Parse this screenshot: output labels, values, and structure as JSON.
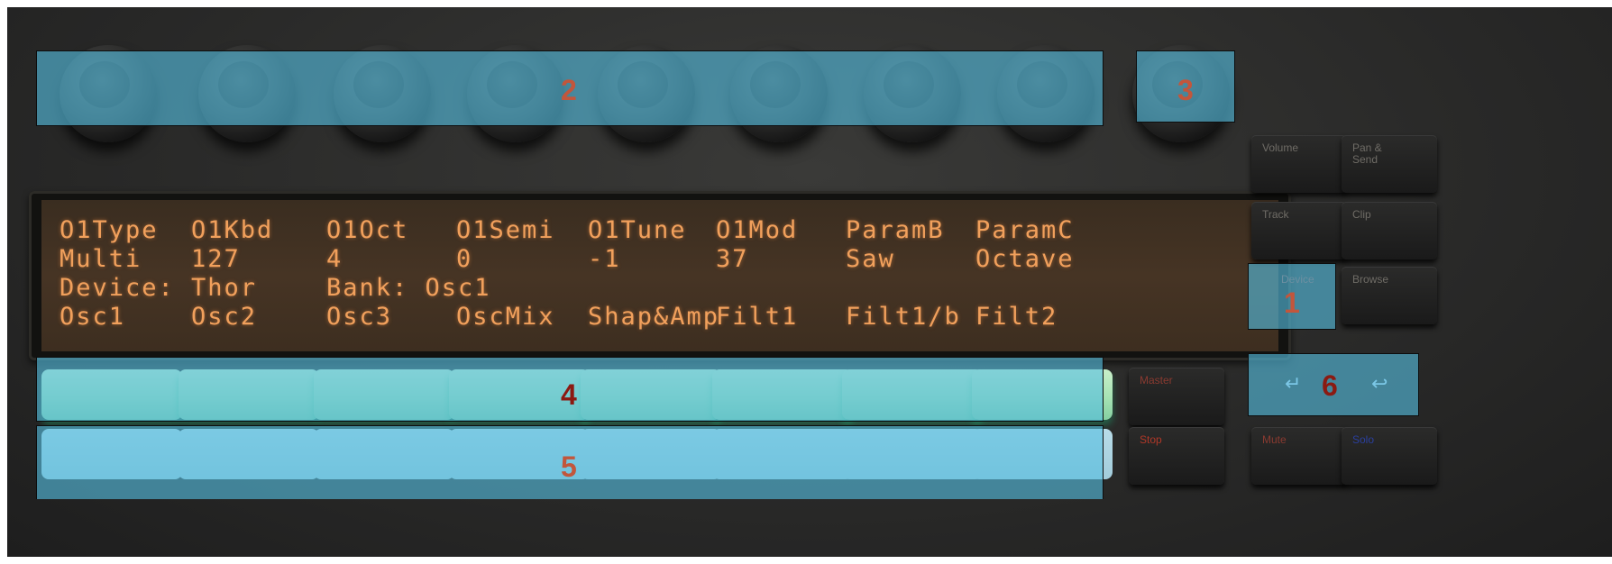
{
  "display": {
    "row1": [
      "O1Type",
      "O1Kbd",
      "O1Oct",
      "O1Semi",
      "O1Tune",
      "O1Mod",
      "ParamB",
      "ParamC"
    ],
    "row2": [
      "Multi",
      "127",
      "4",
      "0",
      "-1",
      "37",
      "Saw",
      "Octave"
    ],
    "device": "Device: Thor",
    "bank": "Bank: Osc1",
    "row4": [
      "Osc1",
      "Osc2",
      "Osc3",
      "OscMix",
      "Shap&Amp",
      "Filt1",
      "Filt1/b",
      "Filt2"
    ]
  },
  "side_buttons": {
    "volume": "Volume",
    "pan_send": "Pan &\nSend",
    "track": "Track",
    "clip": "Clip",
    "device": "Device",
    "browse": "Browse",
    "master": "Master",
    "stop": "Stop",
    "mute": "Mute",
    "solo": "Solo",
    "left_arrow": "↵",
    "right_arrow": "↩"
  },
  "annotations": {
    "label_1": "1",
    "label_2": "2",
    "label_3": "3",
    "label_4": "4",
    "label_5": "5",
    "label_6": "6"
  },
  "colors": {
    "lcd_text": "#f1a05c",
    "overlay": "#56bee1",
    "label_red_dark": "#8b1a12",
    "label_red_light": "#c2563c"
  }
}
